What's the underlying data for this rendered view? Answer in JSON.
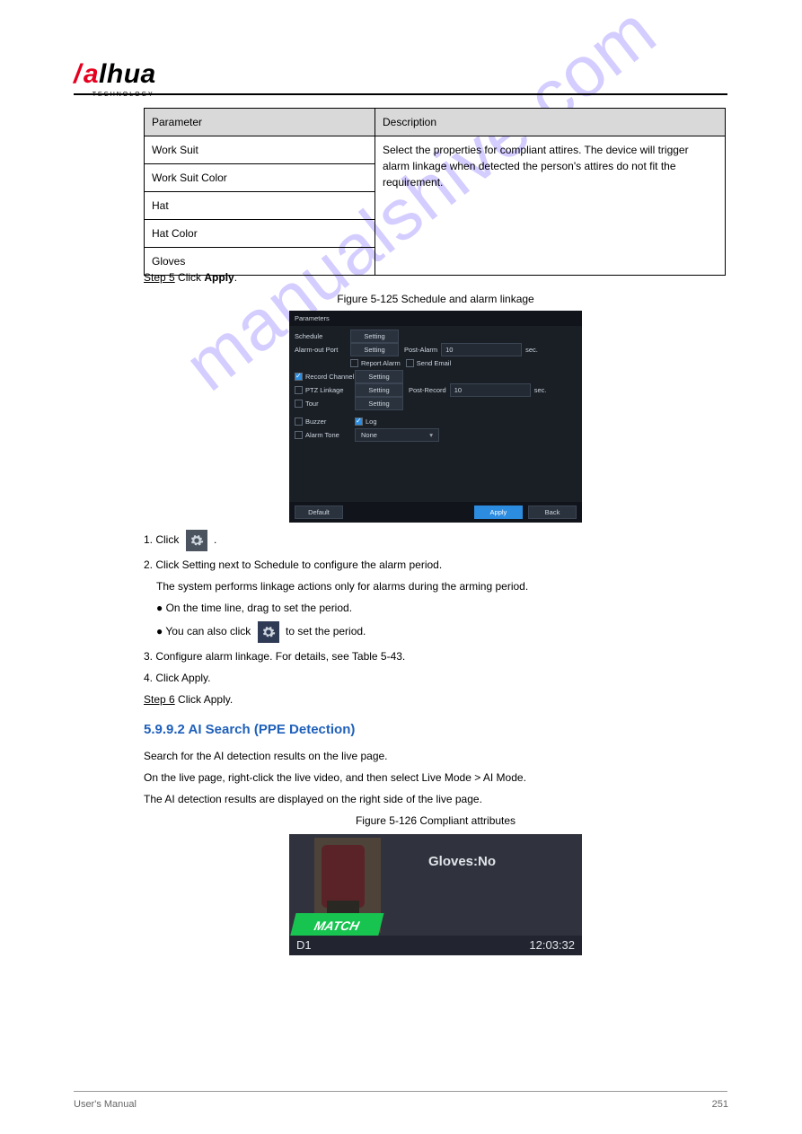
{
  "logo": {
    "word": "alhua",
    "prefix_slash": "/",
    "subtitle": "TECHNOLOGY"
  },
  "watermark": "manualshive.com",
  "footer": {
    "left": "User's Manual",
    "right": "251"
  },
  "table": {
    "head": {
      "c1": "Parameter",
      "c2": "Description"
    },
    "rows": [
      [
        "Work Suit",
        ""
      ],
      [
        "Work Suit Color",
        "Select the properties for compliant attires. The device will trigger alarm linkage"
      ],
      [
        "Hat",
        "when detected the person's attires do not fit the requirement."
      ],
      [
        "Hat Color",
        ""
      ],
      [
        "Gloves",
        ""
      ]
    ]
  },
  "steps": {
    "s5a": "Step 5",
    "s5b": "Click ",
    "apply_word": "Apply",
    "s5c": ".",
    "fig_cap1": "Figure 5-125 Schedule and alarm linkage",
    "dlg": {
      "title": "Parameters",
      "schedule": "Schedule",
      "setting": "Setting",
      "alarm_out": "Alarm-out Port",
      "post_alarm": "Post-Alarm",
      "val10": "10",
      "sec": "sec.",
      "report": "Report Alarm",
      "send_email": "Send Email",
      "record_ch": "Record Channel",
      "ptz": "PTZ Linkage",
      "post_record": "Post-Record",
      "tour": "Tour",
      "buzzer": "Buzzer",
      "log": "Log",
      "alarm_tone": "Alarm Tone",
      "none": "None",
      "default": "Default",
      "apply": "Apply",
      "back": "Back"
    },
    "line1a": "1. Click ",
    "line1b": ".",
    "line2": "2. Click Setting next to Schedule to configure the alarm period.",
    "line3": "The system performs linkage actions only for alarms during the arming period.",
    "bul1": "●  On the time line, drag to set the period.",
    "bul2a": "●  You can also click ",
    "bul2b": " to set the period.",
    "line4": "3. Configure alarm linkage. For details, see Table 5-43.",
    "line5": "4. Click Apply.",
    "s6": "Step 6",
    "s6txt": "Click Apply.",
    "h3": "5.9.9.2 AI Search (PPE Detection)",
    "para1": "Search for the AI detection results on the live page.",
    "para2": "On the live page, right-click the live video, and then select Live Mode > AI Mode.",
    "para3": "The AI detection results are displayed on the right side of the live page.",
    "fig_cap2": "Figure 5-126 Compliant attributes",
    "live": {
      "gloves": "Gloves:No",
      "match": "MATCH",
      "ch": "D1",
      "time": "12:03:32"
    }
  }
}
